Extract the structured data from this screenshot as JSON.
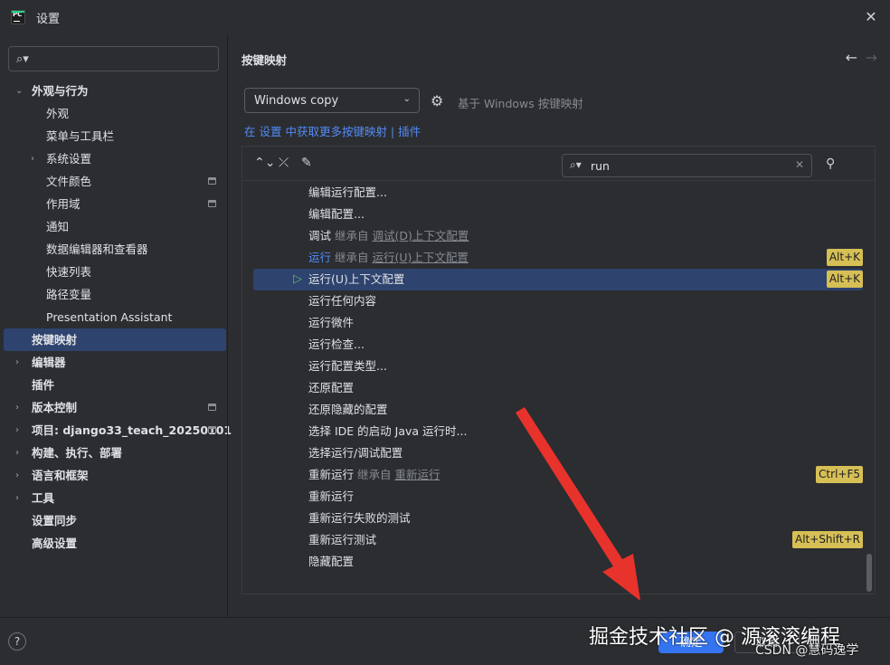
{
  "window": {
    "title": "设置",
    "logo_text": "PC"
  },
  "sidebar": {
    "search_placeholder": "",
    "items": [
      {
        "label": "外观与行为",
        "level": 0,
        "chevron": "down",
        "bold": true
      },
      {
        "label": "外观",
        "level": 1
      },
      {
        "label": "菜单与工具栏",
        "level": 1
      },
      {
        "label": "系统设置",
        "level": 1,
        "chevron": "right"
      },
      {
        "label": "文件颜色",
        "level": 1,
        "badge": true
      },
      {
        "label": "作用域",
        "level": 1,
        "badge": true
      },
      {
        "label": "通知",
        "level": 1
      },
      {
        "label": "数据编辑器和查看器",
        "level": 1
      },
      {
        "label": "快速列表",
        "level": 1
      },
      {
        "label": "路径变量",
        "level": 1
      },
      {
        "label": "Presentation Assistant",
        "level": 1
      },
      {
        "label": "按键映射",
        "level": 0,
        "selected": true,
        "bold": true
      },
      {
        "label": "编辑器",
        "level": 0,
        "chevron": "right",
        "bold": true
      },
      {
        "label": "插件",
        "level": 0,
        "bold": true
      },
      {
        "label": "版本控制",
        "level": 0,
        "chevron": "right",
        "bold": true,
        "badge": true
      },
      {
        "label": "项目: django33_teach_20250101",
        "level": 0,
        "chevron": "right",
        "bold": true,
        "badge": true
      },
      {
        "label": "构建、执行、部署",
        "level": 0,
        "chevron": "right",
        "bold": true
      },
      {
        "label": "语言和框架",
        "level": 0,
        "chevron": "right",
        "bold": true
      },
      {
        "label": "工具",
        "level": 0,
        "chevron": "right",
        "bold": true
      },
      {
        "label": "设置同步",
        "level": 0,
        "bold": true
      },
      {
        "label": "高级设置",
        "level": 0,
        "bold": true
      }
    ]
  },
  "content": {
    "page_title": "按键映射",
    "keymap_value": "Windows copy",
    "based_on": "基于 Windows 按键映射",
    "link_prefix": "在 设置 中获取更多按键映射",
    "link_sep": " | ",
    "link_plugins": "插件",
    "filter_value": "run",
    "rows": [
      {
        "text": "编辑运行配置..."
      },
      {
        "text": "编辑配置..."
      },
      {
        "text": "调试",
        "inherit": "继承自",
        "inherit_link": "调试(D)上下文配置"
      },
      {
        "text": "运行",
        "inherit": "继承自",
        "inherit_link": "运行(U)上下文配置",
        "shortcut": "Alt+K",
        "blue": true
      },
      {
        "text": "运行(U)上下文配置",
        "shortcut": "Alt+K",
        "highlight": true,
        "play": true
      },
      {
        "text": "运行任何内容"
      },
      {
        "text": "运行微件"
      },
      {
        "text": "运行检查..."
      },
      {
        "text": "运行配置类型..."
      },
      {
        "text": "还原配置"
      },
      {
        "text": "还原隐藏的配置"
      },
      {
        "text": "选择 IDE 的启动 Java 运行时..."
      },
      {
        "text": "选择运行/调试配置"
      },
      {
        "text": "重新运行",
        "inherit": "继承自",
        "inherit_link": "重新运行",
        "shortcut": "Ctrl+F5"
      },
      {
        "text": "重新运行"
      },
      {
        "text": "重新运行失败的测试"
      },
      {
        "text": "重新运行测试",
        "shortcut": "Alt+Shift+R"
      },
      {
        "text": "隐藏配置"
      }
    ]
  },
  "footer": {
    "help": "?",
    "ok": "确定",
    "cancel": "取消"
  },
  "overlay": {
    "watermark": "掘金技术社区 @ 源滚滚编程",
    "watermark2": "CSDN @慧码逸学"
  },
  "colors": {
    "accent": "#3574f0",
    "selection": "#2e436e",
    "shortcut_bg": "#d6bf55",
    "arrow": "#e8322c"
  }
}
